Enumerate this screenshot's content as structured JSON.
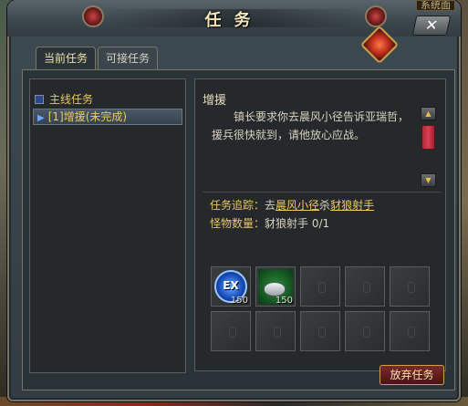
{
  "window": {
    "title": "任务",
    "close_label": "✕"
  },
  "corner_label": "系统面",
  "tabs": [
    {
      "label": "当前任务",
      "active": true
    },
    {
      "label": "可接任务",
      "active": false
    }
  ],
  "quest_tree": {
    "category": "主线任务",
    "items": [
      {
        "label": "[1]增援(未完成)",
        "selected": true
      }
    ]
  },
  "quest_detail": {
    "title": "增援",
    "description": "镇长要求你去晨风小径告诉亚瑞哲，援兵很快就到，请他放心应战。",
    "track_label": "任务追踪：",
    "track_prefix": "去",
    "track_link_1": "晨风小径",
    "track_middle": "杀",
    "track_link_2": "豺狼射手",
    "monster_label": "怪物数量：",
    "monster_value": "豺狼射手 0/1"
  },
  "rewards": [
    {
      "icon": "exp-orb-icon",
      "badge": "EX",
      "count": "150"
    },
    {
      "icon": "silver-coin-icon",
      "count": "150"
    }
  ],
  "scroll": {
    "up": "▲",
    "down": "▼"
  },
  "abandon_button": "放弃任务",
  "colors": {
    "accent_gold": "#e6c766",
    "link": "#f0c860",
    "button_red": "#7a2a2a"
  }
}
